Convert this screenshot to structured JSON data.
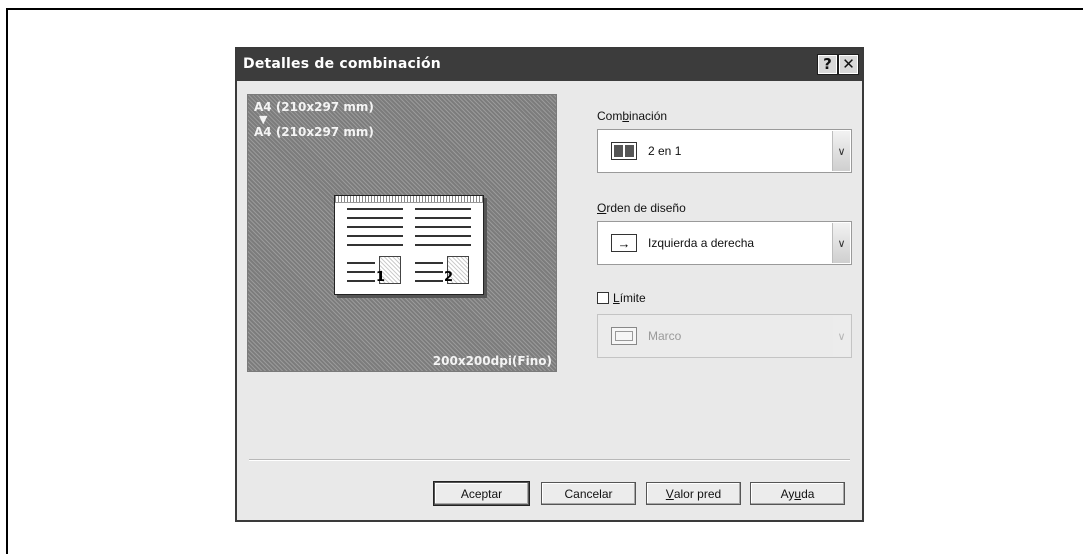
{
  "dialog": {
    "title": "Detalles de combinación",
    "help_button": "?",
    "close_button": "✕"
  },
  "preview": {
    "source_size": "A4 (210x297 mm)",
    "arrow": "▼",
    "target_size": "A4 (210x297 mm)",
    "page_numbers": [
      "1",
      "2"
    ],
    "resolution": "200x200dpi(Fino)"
  },
  "combination": {
    "label_pre": "Com",
    "label_mn": "b",
    "label_post": "inación",
    "value": "2 en 1",
    "icon": "two-up-layout-icon"
  },
  "layout_order": {
    "label_mn": "O",
    "label_post": "rden de diseño",
    "value": "Izquierda a derecha",
    "icon": "right-arrow-icon"
  },
  "border": {
    "label_mn": "L",
    "label_post": "ímite",
    "checked": false,
    "value": "Marco",
    "icon": "frame-icon",
    "enabled": false
  },
  "buttons": {
    "ok": "Aceptar",
    "cancel": "Cancelar",
    "default_pre": "",
    "default_mn": "V",
    "default_post": "alor pred",
    "help_pre": "Ay",
    "help_mn": "u",
    "help_post": "da"
  }
}
